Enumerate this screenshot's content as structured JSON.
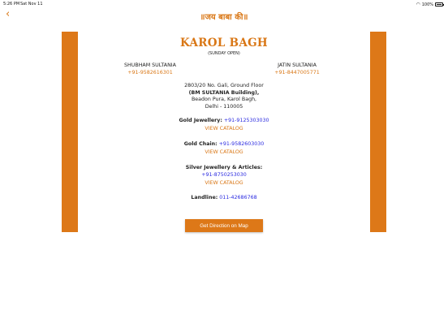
{
  "status_bar": {
    "time": "5:26 PM",
    "date": "Sat Nov 11",
    "battery": "100%"
  },
  "nav": {
    "back_icon": "chevron-left-icon",
    "title": "॥जय बाबा की॥"
  },
  "store": {
    "name": "KAROL BAGH",
    "hours": "(SUNDAY OPEN)",
    "contacts": [
      {
        "name": "SHUBHAM SULTANIA",
        "phone": "+91-9582616301"
      },
      {
        "name": "JATIN SULTANIA",
        "phone": "+91-8447005771"
      }
    ],
    "address": {
      "line1": "2803/20 No. Gali, Ground Floor",
      "line2": "(BM SULTANIA Building),",
      "line3": "Beadon Pura, Karol Bagh,",
      "line4": "Delhi - 110005"
    },
    "sections": {
      "gold_jewellery": {
        "label": "Gold Jewellery:",
        "phone": "+91-9125303030",
        "catalog": "VIEW CATALOG"
      },
      "gold_chain": {
        "label": "Gold Chain:",
        "phone": "+91-9582603030",
        "catalog": "VIEW CATALOG"
      },
      "silver": {
        "label": "Silver Jewellery & Articles:",
        "phone": "+91-8750253030",
        "catalog": "VIEW CATALOG"
      },
      "landline": {
        "label": "Landline:",
        "phone": "011-42686768"
      }
    },
    "map_button": "Get Direction on Map"
  },
  "colors": {
    "accent": "#dd7818",
    "link": "#2a2ae0"
  }
}
